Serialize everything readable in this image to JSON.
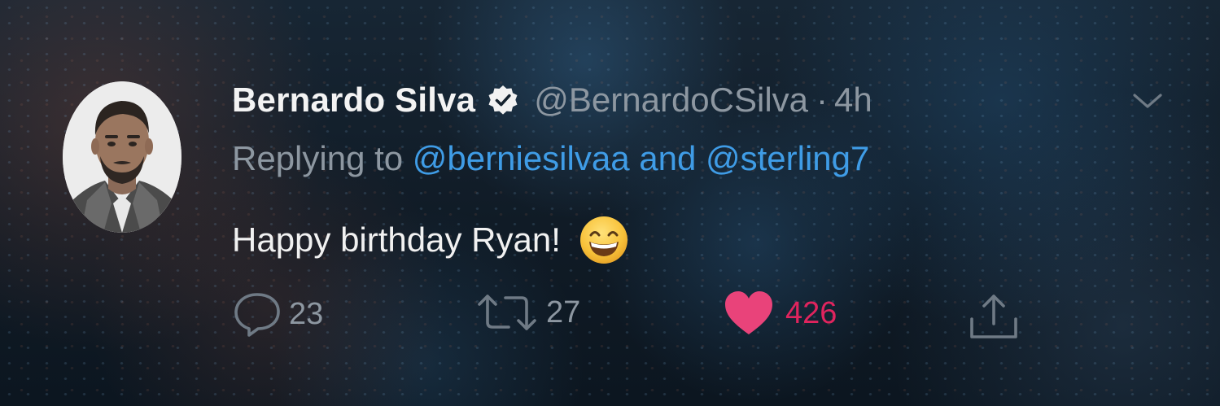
{
  "tweet": {
    "author_name": "Bernardo Silva",
    "handle": "@BernardoCSilva",
    "separator": "·",
    "time": "4h",
    "replying_prefix": "Replying to",
    "mention_1": "@berniesilvaa",
    "and_word": "and",
    "mention_2": "@sterling7",
    "text": "Happy birthday Ryan!",
    "emoji": "grinning-face-with-smiling-eyes"
  },
  "actions": {
    "reply_count": "23",
    "retweet_count": "27",
    "like_count": "426"
  },
  "icons": {
    "verified": "verified-badge-icon",
    "chevron": "chevron-down-icon",
    "reply": "reply-icon",
    "retweet": "retweet-icon",
    "like": "heart-icon",
    "share": "share-icon"
  },
  "colors": {
    "link": "#3f9ce6",
    "like": "#e0245e",
    "muted": "#8d97a1",
    "name": "#f3f3f3"
  }
}
